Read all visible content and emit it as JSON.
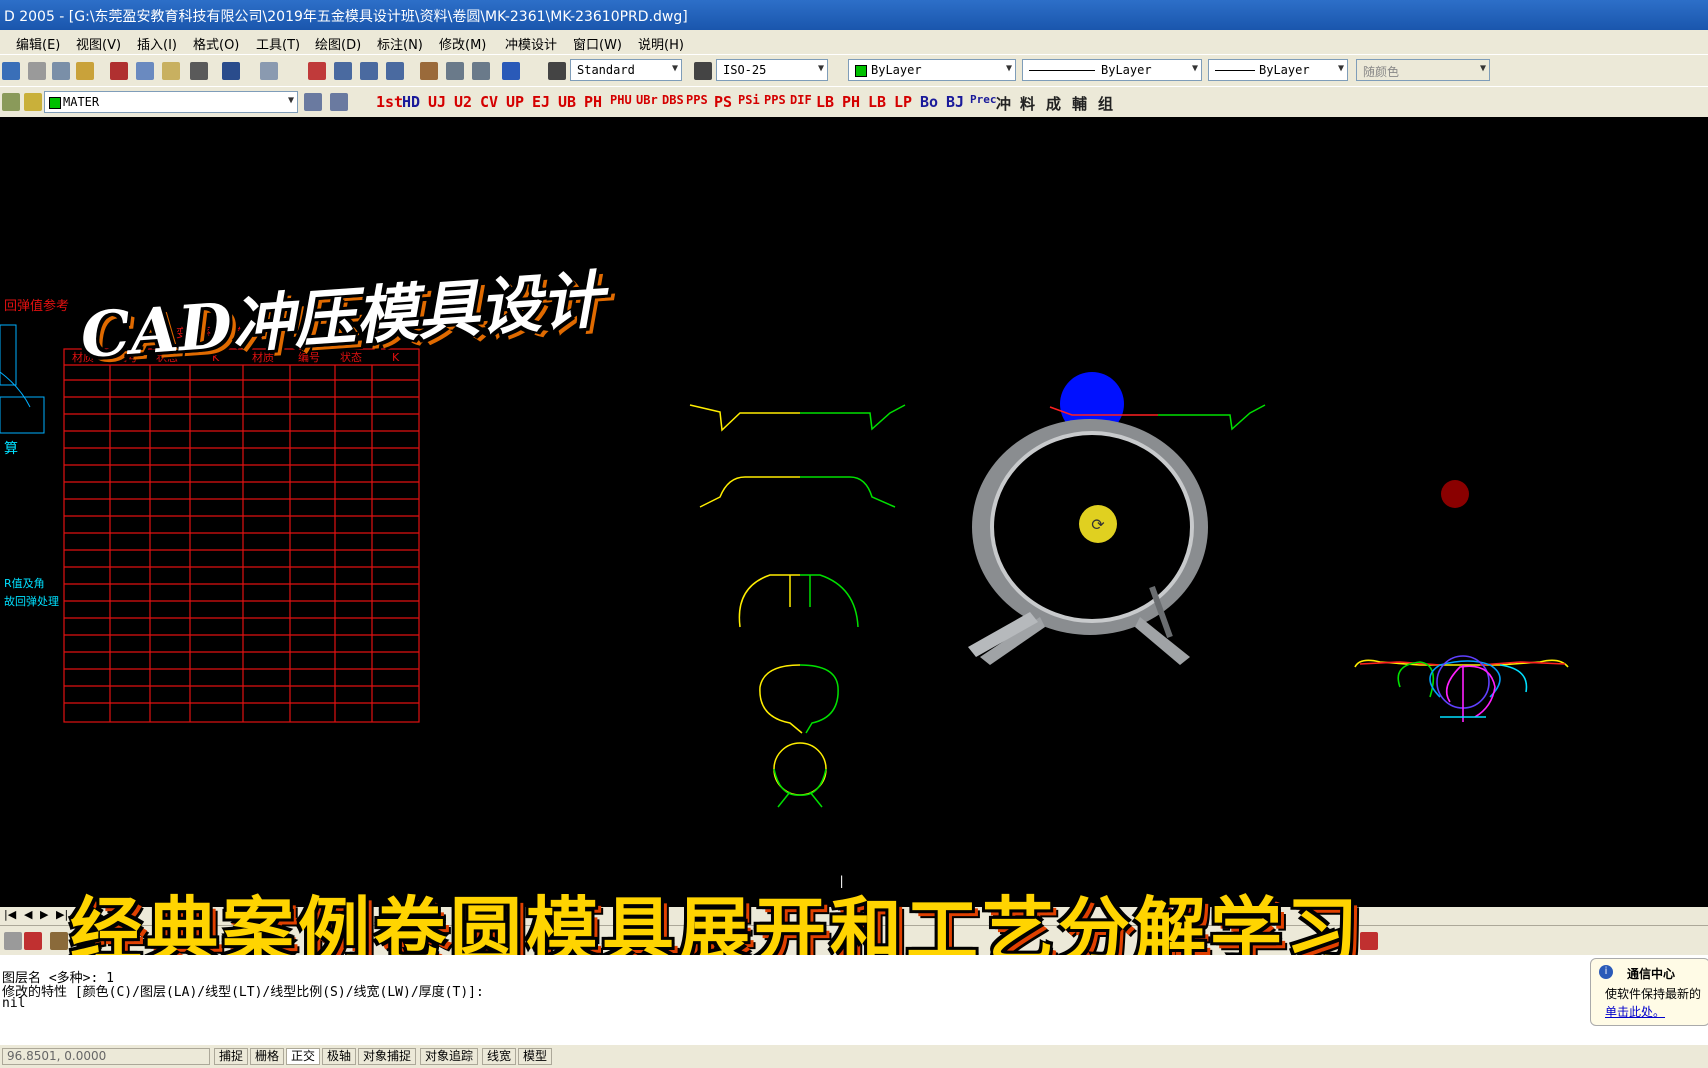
{
  "window": {
    "title": "D 2005 - [G:\\东莞盈安教育科技有限公司\\2019年五金模具设计班\\资料\\卷圆\\MK-2361\\MK-23610PRD.dwg]"
  },
  "menu": [
    "编辑(E)",
    "视图(V)",
    "插入(I)",
    "格式(O)",
    "工具(T)",
    "绘图(D)",
    "标注(N)",
    "修改(M)",
    "冲模设计",
    "窗口(W)",
    "说明(H)"
  ],
  "toolbar": {
    "text_style": "Standard",
    "dim_style": "ISO-25",
    "layer_color": "ByLayer",
    "linetype": "ByLayer",
    "lineweight": "ByLayer",
    "plot_style": "随颜色",
    "layer_name": "MATER",
    "custom_commands": [
      "1st",
      "HD",
      "UJ",
      "U2",
      "CV",
      "UP",
      "EJ",
      "UB",
      "PH",
      "PHU",
      "UBr",
      "DBS",
      "PPS",
      "PS",
      "PSi",
      "PPS",
      "DIF",
      "LB",
      "PH",
      "LB",
      "LP",
      "Bo",
      "BJ",
      "Prec",
      "冲",
      "料",
      "成",
      "輔",
      "组"
    ]
  },
  "drawing": {
    "table": {
      "header_left": "回弹值参考",
      "header_title": "变化系数K值参考",
      "columns": [
        "材质",
        "编号",
        "状态",
        "K",
        "材质",
        "编号",
        "状态",
        "K"
      ]
    },
    "side_notes": [
      "算",
      "R值及角",
      "故回弹处理"
    ]
  },
  "overlay": {
    "title": "CAD冲压模具设计",
    "subtitle": "经典案例卷圆模具展开和工艺分解学习"
  },
  "command_line": {
    "line1": "图层名 <多种>: 1",
    "line2": "修改的特性 [颜色(C)/图层(LA)/线型(LT)/线型比例(S)/线宽(LW)/厚度(T)]:",
    "line3": "nil"
  },
  "status_bar": {
    "coords": "96.8501, 0.0000",
    "toggles": [
      "捕捉",
      "栅格",
      "正交",
      "极轴",
      "对象捕捉",
      "对象追踪",
      "线宽",
      "模型"
    ]
  },
  "notification": {
    "title": "通信中心",
    "body": "使软件保持最新的",
    "link": "单击此处。"
  },
  "colors": {
    "titlebar": "#1a56ad",
    "chrome": "#ece9d8",
    "canvas": "#000000",
    "table_red": "#e01010",
    "accent_yellow": "#ffd400"
  }
}
